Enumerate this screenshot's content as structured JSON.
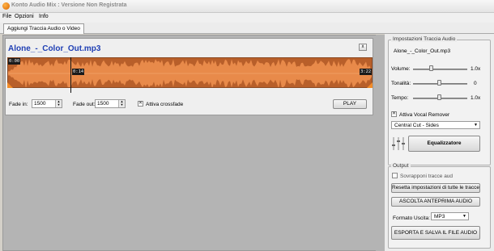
{
  "window": {
    "title": "Konto Audio Mix : Versione Non Registrata"
  },
  "menu": [
    "File",
    "Opzioni",
    "Info"
  ],
  "tabs": {
    "active": "Aggiungi Traccia Audio o Video"
  },
  "track": {
    "filename": "Alone_-_Color_Out.mp3",
    "close_label": "x",
    "time_start": "0:00",
    "time_cursor": "0:14",
    "time_end": "3:22",
    "cursor_position_fraction": 0.18,
    "fade_in_label": "Fade in:",
    "fade_in_value": "1500",
    "fade_out_label": "Fade out:",
    "fade_out_value": "1500",
    "crossfade_label": "Attiva crossfade",
    "crossfade_checked": true,
    "play_label": "PLAY"
  },
  "settings": {
    "group_title": "Impostazioni Traccia Audio",
    "track_name": "Alone_-_Color_Out.mp3",
    "volume_label": "Volume:",
    "volume_value": "1.0x",
    "tonality_label": "Tonalità:",
    "tonality_value": "0",
    "tempo_label": "Tempo:",
    "tempo_value": "1.0x",
    "vocal_remover_label": "Attiva Vocal Remover",
    "vocal_remover_checked": true,
    "vocal_mode": "Central Cut - Sides",
    "equalizer_label": "Equalizzatore"
  },
  "output": {
    "group_title": "Output",
    "overlap_label": "Sovrapponi tracce aud",
    "overlap_checked": false,
    "reset_label": "Resetta impostazioni di tutte le tracce",
    "preview_label": "ASCOLTA ANTEPRIMA AUDIO",
    "format_label": "Formato Uscita:",
    "format_value": "MP3",
    "export_label": "ESPORTA E SALVA IL FILE AUDIO"
  },
  "colors": {
    "waveform_bg": "#b85f2a",
    "waveform_fg": "#e88a4a",
    "trackname": "#1f3fb4",
    "workarea": "#b4b4b4"
  },
  "icons": {
    "app": "app-logo-icon",
    "close": "close-icon",
    "checkbox": "checkmark-icon",
    "equalizer": "equalizer-sliders-icon",
    "dropdown": "chevron-down-icon"
  }
}
